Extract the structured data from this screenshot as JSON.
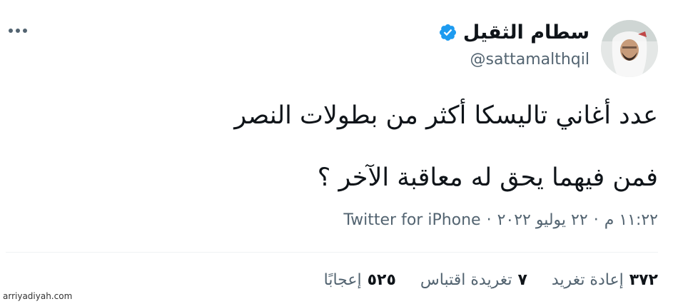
{
  "author": {
    "display_name": "سطام الثقيل",
    "handle": "@sattamalthqil",
    "verified": true
  },
  "tweet": {
    "line_1": "عدد أغاني تاليسكا أكثر من بطولات النصر",
    "line_2": "فمن فيهما يحق له معاقبة الآخر ؟"
  },
  "meta": {
    "time": "١١:٢٢ م",
    "separator": "·",
    "date": "٢٢ يوليو ٢٠٢٢",
    "source": "Twitter for iPhone"
  },
  "stats": [
    {
      "count": "٣٧٢",
      "label": "إعادة تغريد"
    },
    {
      "count": "٧",
      "label": "تغريدة اقتباس"
    },
    {
      "count": "٥٢٥",
      "label": "إعجابًا"
    }
  ],
  "watermark": "arriyadiyah.com",
  "colors": {
    "text": "#0f1419",
    "secondary": "#536471",
    "verified": "#1d9bf0",
    "divider": "#eff3f4"
  },
  "icons": {
    "verified": "verified-badge-icon",
    "more": "more-dots-icon"
  }
}
